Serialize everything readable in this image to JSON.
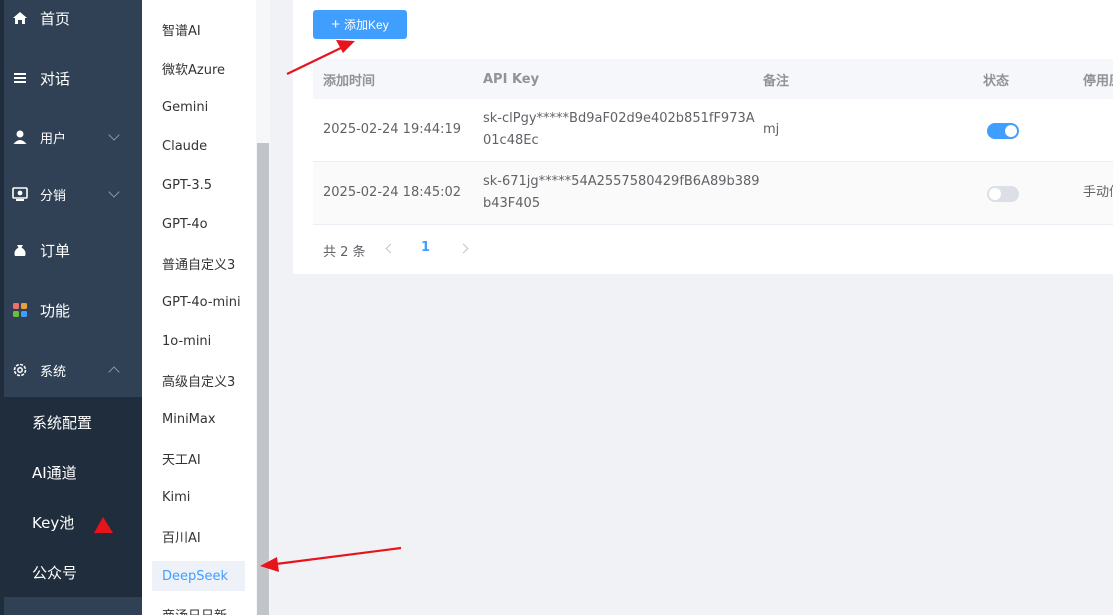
{
  "sidebar": {
    "items": [
      {
        "label": "首页",
        "icon": "home-icon"
      },
      {
        "label": "对话",
        "icon": "list-icon"
      },
      {
        "label": "用户",
        "icon": "user-icon"
      },
      {
        "label": "分销",
        "icon": "distribution-icon"
      },
      {
        "label": "订单",
        "icon": "money-bag-icon"
      },
      {
        "label": "功能",
        "icon": "grid-icon"
      },
      {
        "label": "系统",
        "icon": "gear-icon"
      }
    ],
    "submenu": [
      {
        "label": "系统配置"
      },
      {
        "label": "AI通道"
      },
      {
        "label": "Key池"
      },
      {
        "label": "公众号"
      }
    ]
  },
  "providers": [
    "智谱AI",
    "微软Azure",
    "Gemini",
    "Claude",
    "GPT-3.5",
    "GPT-4o",
    "普通自定义3",
    "GPT-4o-mini",
    "1o-mini",
    "高级自定义3",
    "MiniMax",
    "天工AI",
    "Kimi",
    "百川AI",
    "DeepSeek",
    "商汤日日新"
  ],
  "toolbar": {
    "add_label": "添加Key",
    "add_icon": "+"
  },
  "table": {
    "headers": [
      "添加时间",
      "API Key",
      "备注",
      "状态",
      "停用原因"
    ],
    "rows": [
      {
        "time": "2025-02-24 19:44:19",
        "key_line1": "sk-clPgy*****Bd9aF02d9e402b851fF973A",
        "key_line2": "01c48Ec",
        "note": "mj",
        "enabled": true,
        "reason": ""
      },
      {
        "time": "2025-02-24 18:45:02",
        "key_line1": "sk-671jg*****54A2557580429fB6A89b389",
        "key_line2": "b43F405",
        "note": "",
        "enabled": false,
        "reason": "手动停用"
      }
    ]
  },
  "pagination": {
    "total": "共 2 条",
    "current": "1"
  },
  "colors": {
    "accent": "#409eff",
    "sidebar_bg": "#304156",
    "annotation": "#e8141c"
  }
}
